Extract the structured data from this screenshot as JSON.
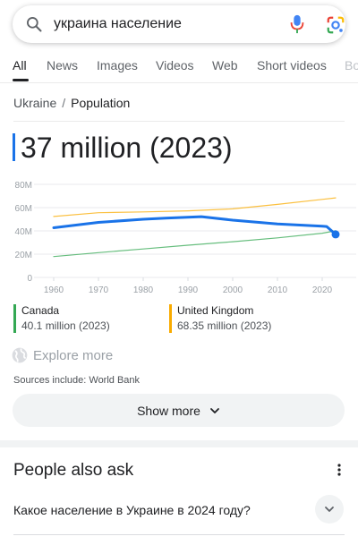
{
  "search": {
    "query": "украина население"
  },
  "tabs": [
    {
      "label": "All",
      "active": true
    },
    {
      "label": "News"
    },
    {
      "label": "Images"
    },
    {
      "label": "Videos"
    },
    {
      "label": "Web"
    },
    {
      "label": "Short videos"
    },
    {
      "label": "Bo"
    }
  ],
  "breadcrumb": {
    "parent": "Ukraine",
    "separator": "/",
    "current": "Population"
  },
  "answer": {
    "value": "37 million (2023)",
    "accent": "#1a73e8"
  },
  "chart_data": {
    "type": "line",
    "x_ticks": [
      "1960",
      "1970",
      "1980",
      "1990",
      "2000",
      "2010",
      "2020"
    ],
    "y_ticks": [
      "0",
      "20M",
      "40M",
      "60M",
      "80M"
    ],
    "ylim": [
      0,
      80
    ],
    "xlim": [
      1958,
      2025
    ],
    "series": [
      {
        "name": "Ukraine",
        "color": "#1a73e8",
        "x": [
          1960,
          1970,
          1980,
          1985,
          1993,
          2000,
          2010,
          2020,
          2021,
          2023
        ],
        "y": [
          42.7,
          47.3,
          50.0,
          50.9,
          52.2,
          49.2,
          46.0,
          44.1,
          43.8,
          37.0
        ]
      },
      {
        "name": "United Kingdom",
        "color": "#f9ab00",
        "x": [
          1960,
          1970,
          1980,
          1990,
          2000,
          2010,
          2020,
          2023
        ],
        "y": [
          52.4,
          55.6,
          56.3,
          57.2,
          58.9,
          62.8,
          67.1,
          68.35
        ]
      },
      {
        "name": "Canada",
        "color": "#34a853",
        "x": [
          1960,
          1970,
          1980,
          1990,
          2000,
          2010,
          2020,
          2023
        ],
        "y": [
          17.9,
          21.3,
          24.5,
          27.7,
          30.7,
          34.0,
          38.0,
          40.1
        ]
      }
    ]
  },
  "legend": [
    {
      "name": "Canada",
      "value": "40.1 million (2023)",
      "color": "#34a853"
    },
    {
      "name": "United Kingdom",
      "value": "68.35 million (2023)",
      "color": "#f9ab00"
    }
  ],
  "explore": {
    "label": "Explore more"
  },
  "sources": {
    "text": "Sources include: World Bank"
  },
  "show_more": {
    "label": "Show more"
  },
  "people_also_ask": {
    "title": "People also ask",
    "questions": [
      "Какое население в Украине в 2024 году?"
    ]
  }
}
